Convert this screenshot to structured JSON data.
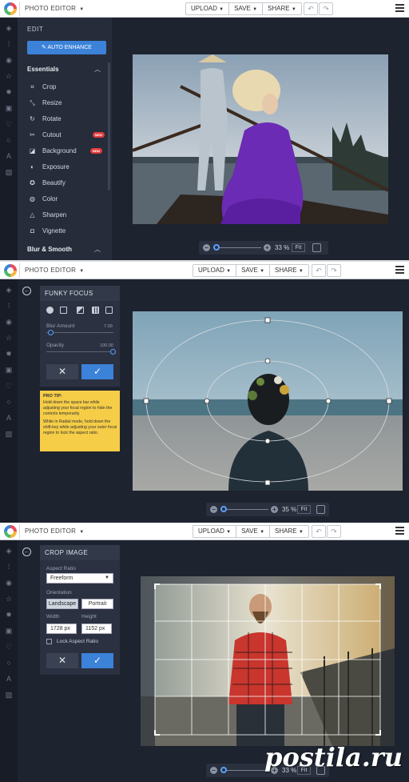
{
  "app": {
    "name": "PHOTO EDITOR",
    "upload": "UPLOAD",
    "save": "SAVE",
    "share": "SHARE"
  },
  "panel1": {
    "edit_title": "EDIT",
    "auto_enhance": "AUTO ENHANCE",
    "essentials": "Essentials",
    "tools": [
      {
        "label": "Crop",
        "icon": "crop-icon",
        "glyph": "⌗",
        "new": false
      },
      {
        "label": "Resize",
        "icon": "resize-icon",
        "glyph": "⤡",
        "new": false
      },
      {
        "label": "Rotate",
        "icon": "rotate-icon",
        "glyph": "↻",
        "new": false
      },
      {
        "label": "Cutout",
        "icon": "scissors-icon",
        "glyph": "✂",
        "new": true
      },
      {
        "label": "Background",
        "icon": "background-icon",
        "glyph": "◪",
        "new": true
      },
      {
        "label": "Exposure",
        "icon": "exposure-icon",
        "glyph": "◐",
        "new": false
      },
      {
        "label": "Beautify",
        "icon": "beautify-icon",
        "glyph": "✪",
        "new": false
      },
      {
        "label": "Color",
        "icon": "color-icon",
        "glyph": "◍",
        "new": false
      },
      {
        "label": "Sharpen",
        "icon": "sharpen-icon",
        "glyph": "△",
        "new": false
      },
      {
        "label": "Vignette",
        "icon": "vignette-icon",
        "glyph": "◘",
        "new": false
      }
    ],
    "new_badge": "NEW",
    "blur_smooth": "Blur & Smooth",
    "zoom": "33 %",
    "fit": "Fit"
  },
  "panel2": {
    "title": "FUNKY FOCUS",
    "blur_amount_label": "Blur Amount",
    "blur_amount_value": "7.00",
    "opacity_label": "Opacity",
    "opacity_value": "100.00",
    "tip_title": "PRO TIP:",
    "tip_text1": "Hold down the space bar while adjusting your focal region to hide the controls temporarily.",
    "tip_text2": "While in Radial mode, hold down the shift-key while adjusting your outer focal region to lock the aspect ratio.",
    "zoom": "35 %",
    "fit": "Fit"
  },
  "panel3": {
    "title": "CROP IMAGE",
    "aspect_label": "Aspect Ratio",
    "aspect_value": "Freeform",
    "orientation_label": "Orientation",
    "landscape": "Landscape",
    "portrait": "Portrait",
    "width_label": "Width",
    "height_label": "Height",
    "width_value": "1728 px",
    "height_value": "1152 px",
    "lock_label": "Lock Aspect Ratio",
    "zoom": "33 %",
    "fit": "Fit"
  },
  "watermark": "postila.ru",
  "colors": {
    "accent": "#3b82d8",
    "dark_bg": "#1e2330",
    "tip": "#f5cd47",
    "new_badge": "#e23c3c"
  }
}
